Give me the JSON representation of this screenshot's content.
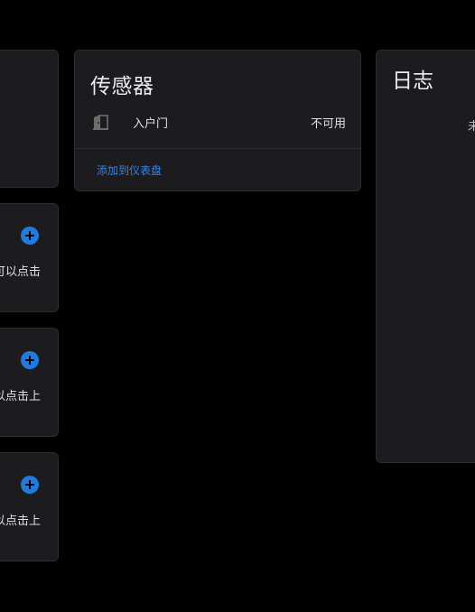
{
  "left_column": {
    "cards": [
      {
        "text_fragment": "可以点击"
      },
      {
        "text_fragment": "以点击上"
      },
      {
        "text_fragment": "以点击上"
      }
    ],
    "add_icon": "plus-circle-icon"
  },
  "sensor_card": {
    "title": "传感器",
    "entity": {
      "icon": "door-icon",
      "name": "入户门",
      "state": "不可用"
    },
    "add_to_dashboard_label": "添加到仪表盘"
  },
  "log_card": {
    "title": "日志",
    "text_fragment": "未"
  },
  "colors": {
    "background": "#000000",
    "card": "#1c1c1e",
    "accent": "#1e7be0",
    "link": "#2f86e8"
  }
}
